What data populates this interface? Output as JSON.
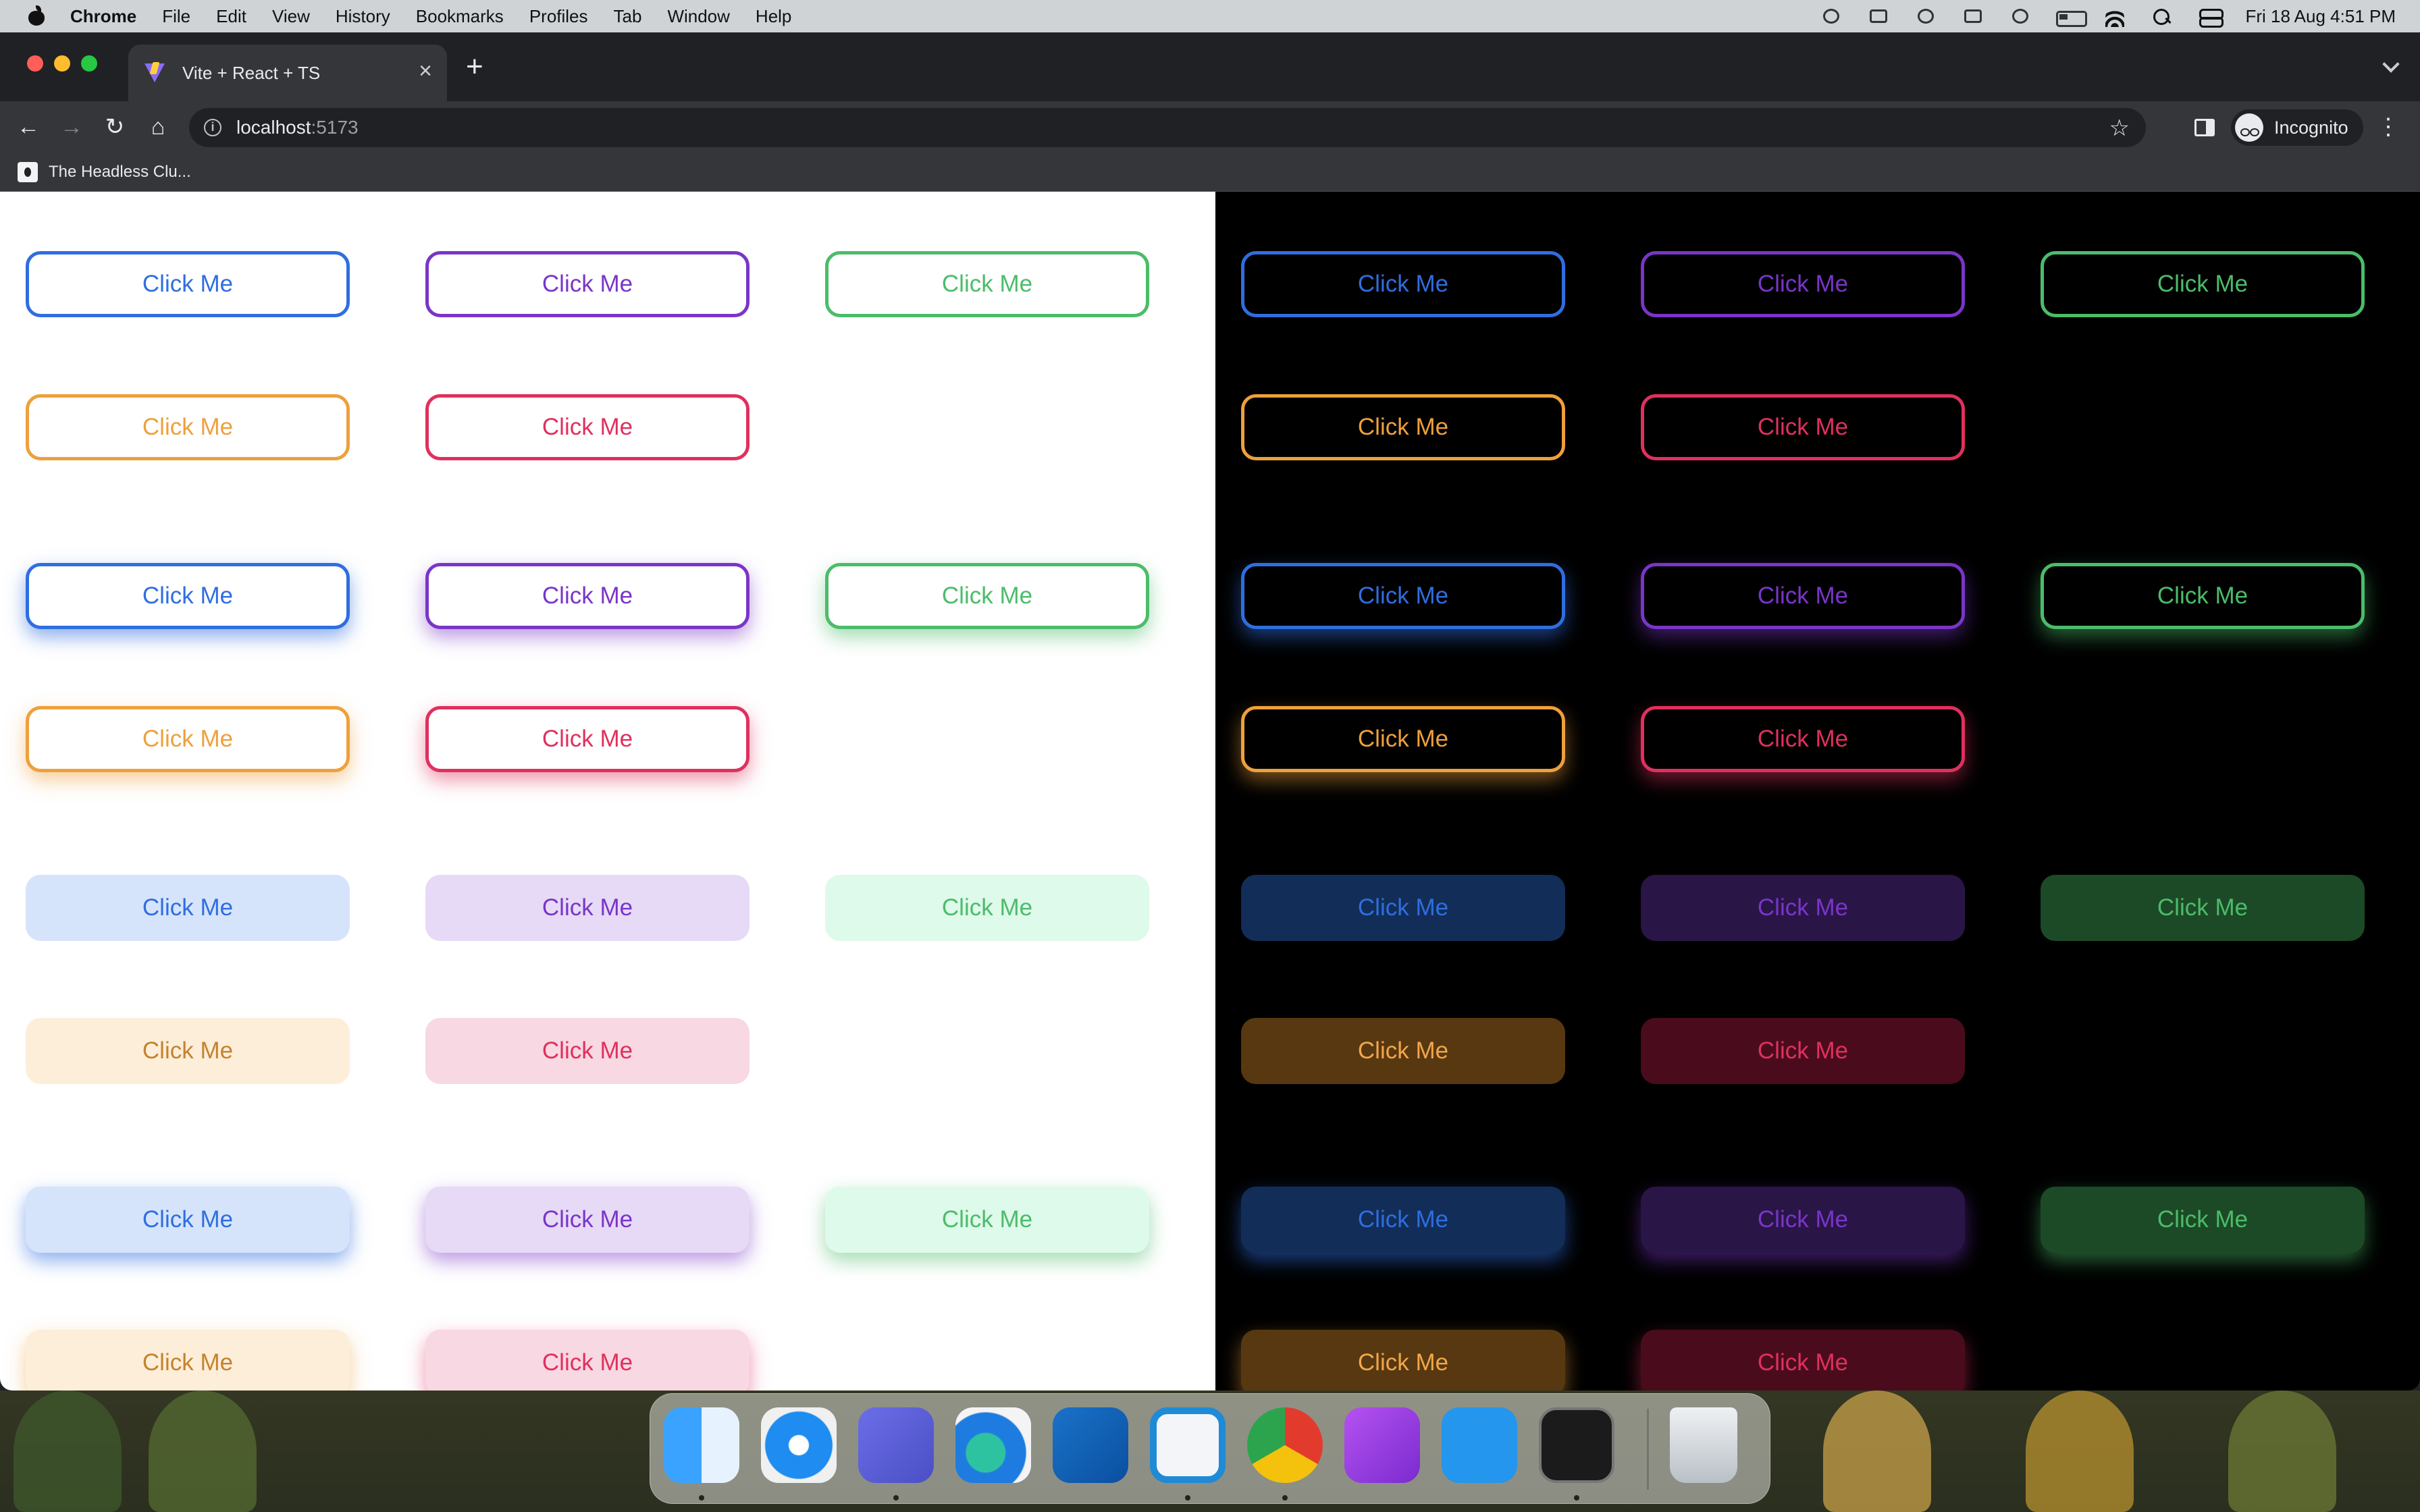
{
  "menubar": {
    "app": "Chrome",
    "items": [
      "File",
      "Edit",
      "View",
      "History",
      "Bookmarks",
      "Profiles",
      "Tab",
      "Window",
      "Help"
    ],
    "clock": "Fri 18 Aug  4:51 PM"
  },
  "browser": {
    "tab_title": "Vite + React + TS",
    "url_host": "localhost",
    "url_port": ":5173",
    "profile": "Incognito",
    "bookmark": "The Headless Clu..."
  },
  "button_label": "Click Me",
  "rows": [
    {
      "row": [
        {
          "label": "Click Me",
          "variant": "outline",
          "color": "#2f6ee0"
        },
        {
          "label": "Click Me",
          "variant": "outline",
          "color": "#7a35c8"
        },
        {
          "label": "Click Me",
          "variant": "outline",
          "color": "#4cbc6a"
        }
      ]
    }
  ],
  "colors": {
    "blue": "#2f6ee0",
    "purple": "#7a35c8",
    "green": "#4cbc6a",
    "orange": "#eea03c",
    "red": "#e0305e",
    "light_background": "#ffffff",
    "dark_background": "#000000"
  },
  "dock": {
    "apps": [
      "finder-icon",
      "safari-icon",
      "teams-icon",
      "edge-icon",
      "outlook-icon",
      "vscode-icon",
      "chrome-icon",
      "ploomber-icon",
      "docker-icon",
      "terminal-icon",
      "trash-icon"
    ]
  }
}
